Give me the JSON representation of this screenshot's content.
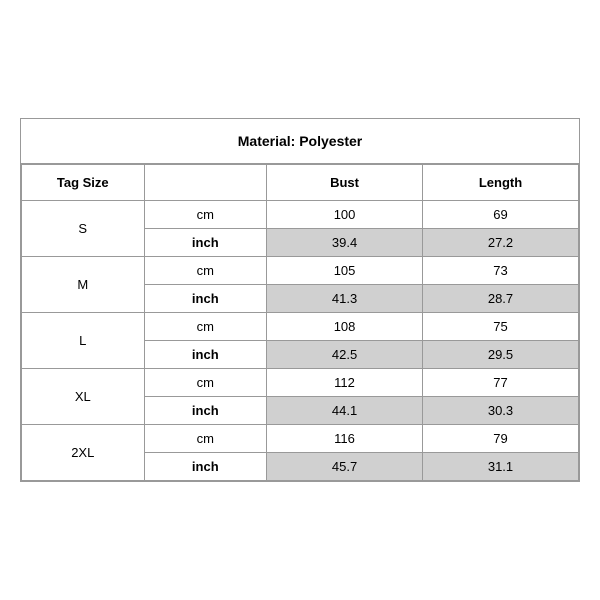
{
  "title": "Material: Polyester",
  "headers": {
    "tag_size": "Tag Size",
    "bust": "Bust",
    "length": "Length"
  },
  "sizes": [
    {
      "label": "S",
      "cm": {
        "bust": "100",
        "length": "69"
      },
      "inch": {
        "bust": "39.4",
        "length": "27.2"
      }
    },
    {
      "label": "M",
      "cm": {
        "bust": "105",
        "length": "73"
      },
      "inch": {
        "bust": "41.3",
        "length": "28.7"
      }
    },
    {
      "label": "L",
      "cm": {
        "bust": "108",
        "length": "75"
      },
      "inch": {
        "bust": "42.5",
        "length": "29.5"
      }
    },
    {
      "label": "XL",
      "cm": {
        "bust": "112",
        "length": "77"
      },
      "inch": {
        "bust": "44.1",
        "length": "30.3"
      }
    },
    {
      "label": "2XL",
      "cm": {
        "bust": "116",
        "length": "79"
      },
      "inch": {
        "bust": "45.7",
        "length": "31.1"
      }
    }
  ],
  "units": {
    "cm": "cm",
    "inch": "inch"
  }
}
